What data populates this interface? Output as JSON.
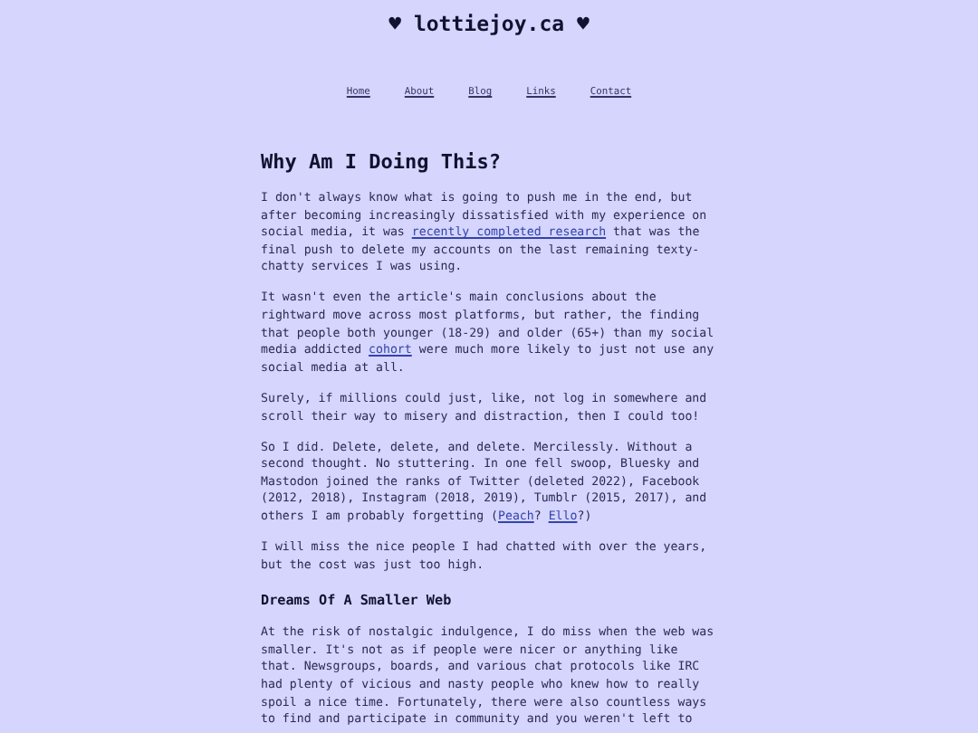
{
  "site_title": "♥ lottiejoy.ca ♥",
  "nav": [
    "Home",
    "About",
    "Blog",
    "Links",
    "Contact"
  ],
  "article": {
    "title": "Why Am I Doing This?",
    "blocks": [
      {
        "kind": "paragraph",
        "parts": [
          {
            "kind": "text",
            "text": "I don't always know what is going to push me in the end, but after becoming increasingly dissatisfied with my experience on social media, it was "
          },
          {
            "kind": "link",
            "text": "recently completed research"
          },
          {
            "kind": "text",
            "text": " that was the final push to delete my accounts on the last remaining texty-chatty services I was using."
          }
        ]
      },
      {
        "kind": "paragraph",
        "parts": [
          {
            "kind": "text",
            "text": "It wasn't even the article's main conclusions about the rightward move across most platforms, but rather, the finding that people both younger (18-29) and older (65+) than my social media addicted "
          },
          {
            "kind": "link",
            "text": "cohort"
          },
          {
            "kind": "text",
            "text": " were much more likely to just not use any social media at all."
          }
        ]
      },
      {
        "kind": "paragraph",
        "parts": [
          {
            "kind": "text",
            "text": "Surely, if millions could just, like, not log in somewhere and scroll their way to misery and distraction, then I could too!"
          }
        ]
      },
      {
        "kind": "paragraph",
        "parts": [
          {
            "kind": "text",
            "text": "So I did. Delete, delete, and delete. Mercilessly. Without a second thought. No stuttering. In one fell swoop, Bluesky and Mastodon joined the ranks of Twitter (deleted 2022), Facebook (2012, 2018), Instagram (2018, 2019), Tumblr (2015, 2017), and others I am probably forgetting ("
          },
          {
            "kind": "link",
            "text": "Peach"
          },
          {
            "kind": "text",
            "text": "? "
          },
          {
            "kind": "link",
            "text": "Ello"
          },
          {
            "kind": "text",
            "text": "?)"
          }
        ]
      },
      {
        "kind": "paragraph",
        "parts": [
          {
            "kind": "text",
            "text": "I will miss the nice people I had chatted with over the years, but the cost was just too high."
          }
        ]
      },
      {
        "kind": "subheading",
        "parts": [
          {
            "kind": "text",
            "text": "Dreams Of A Smaller Web"
          }
        ]
      },
      {
        "kind": "paragraph",
        "parts": [
          {
            "kind": "text",
            "text": "At the risk of nostalgic indulgence, I do miss when the web was smaller. It's not as if people were nicer or anything like that. Newsgroups, boards, and various chat protocols like IRC had plenty of vicious and nasty people who knew how to really spoil a nice time. Fortunately, there were also countless ways to find and participate in community and you weren't left to"
          }
        ]
      }
    ]
  }
}
